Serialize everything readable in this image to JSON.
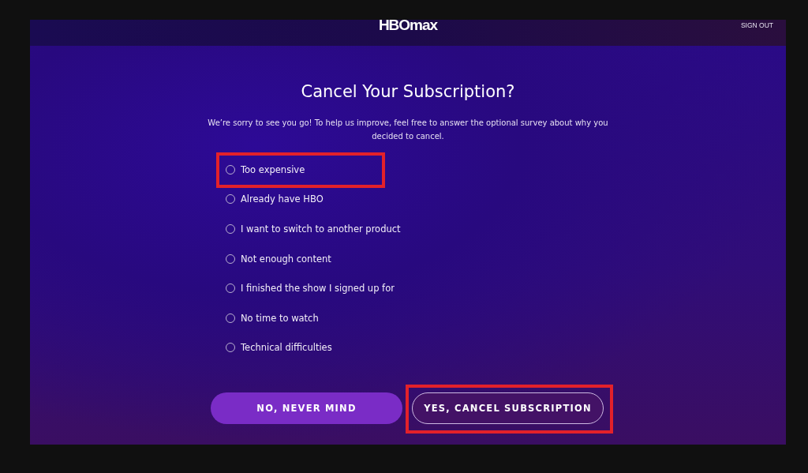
{
  "header": {
    "logo": "HBOmax",
    "sign_out": "SIGN OUT"
  },
  "title": "Cancel Your Subscription?",
  "description": "We’re sorry to see you go! To help us improve, feel free to answer the optional survey about why you decided to cancel.",
  "options": [
    {
      "label": "Too expensive",
      "selected": false,
      "highlighted": true
    },
    {
      "label": "Already have HBO",
      "selected": false,
      "highlighted": false
    },
    {
      "label": "I want to switch to another product",
      "selected": false,
      "highlighted": false
    },
    {
      "label": "Not enough content",
      "selected": false,
      "highlighted": false
    },
    {
      "label": "I finished the show I signed up for",
      "selected": false,
      "highlighted": false
    },
    {
      "label": "No time to watch",
      "selected": false,
      "highlighted": false
    },
    {
      "label": "Technical difficulties",
      "selected": false,
      "highlighted": false
    }
  ],
  "buttons": [
    {
      "label": "NO, NEVER MIND",
      "kind": "filled",
      "highlighted": false
    },
    {
      "label": "YES, CANCEL SUBSCRIPTION",
      "kind": "outline",
      "highlighted": true
    }
  ]
}
